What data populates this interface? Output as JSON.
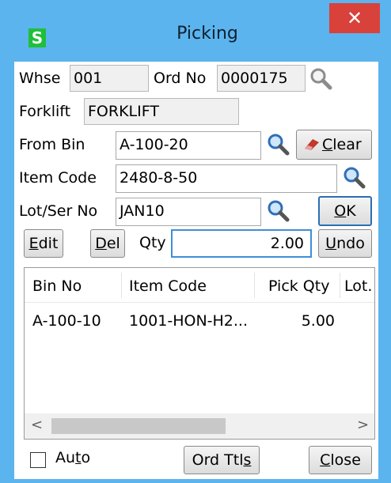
{
  "window": {
    "title": "Picking",
    "app_icon_letter": "S",
    "close_glyph": "✕"
  },
  "header": {
    "whse_label": "Whse",
    "whse_value": "001",
    "ord_no_label": "Ord No",
    "ord_no_value": "0000175",
    "forklift_label": "Forklift",
    "forklift_value": "FORKLIFT"
  },
  "form": {
    "from_bin_label": "From Bin",
    "from_bin_value": "A-100-20",
    "item_code_label": "Item Code",
    "item_code_value": "2480-8-50",
    "lot_ser_label": "Lot/Ser No",
    "lot_ser_value": "JAN10",
    "qty_label": "Qty",
    "qty_value": "2.00"
  },
  "buttons": {
    "clear": "Clear",
    "clear_accel": "C",
    "clear_rest": "lear",
    "ok": "OK",
    "ok_accel": "O",
    "ok_rest": "K",
    "edit_accel": "E",
    "edit_rest": "dit",
    "del_accel": "D",
    "del_rest": "el",
    "undo_accel": "U",
    "undo_rest": "ndo",
    "ord_ttls_pre": "Ord Ttl",
    "ord_ttls_accel": "s",
    "close_accel": "C",
    "close_rest": "lose"
  },
  "grid": {
    "columns": [
      "Bin No",
      "Item Code",
      "Pick Qty",
      "Lot."
    ],
    "rows": [
      {
        "bin_no": "A-100-10",
        "item_code": "1001-HON-H2...",
        "pick_qty": "5.00",
        "lot": ""
      }
    ],
    "scroll_left": "<",
    "scroll_right": ">"
  },
  "footer": {
    "auto_label_pre": "Au",
    "auto_label_accel": "t",
    "auto_label_post": "o",
    "auto_checked": false
  },
  "colors": {
    "titlebar": "#5bb4ee",
    "close_button": "#d9413b",
    "app_icon": "#1fbf3a",
    "focus_border": "#3c8fd8"
  },
  "icons": [
    "magnifier-gray-icon",
    "magnifier-blue-icon",
    "eraser-icon"
  ]
}
